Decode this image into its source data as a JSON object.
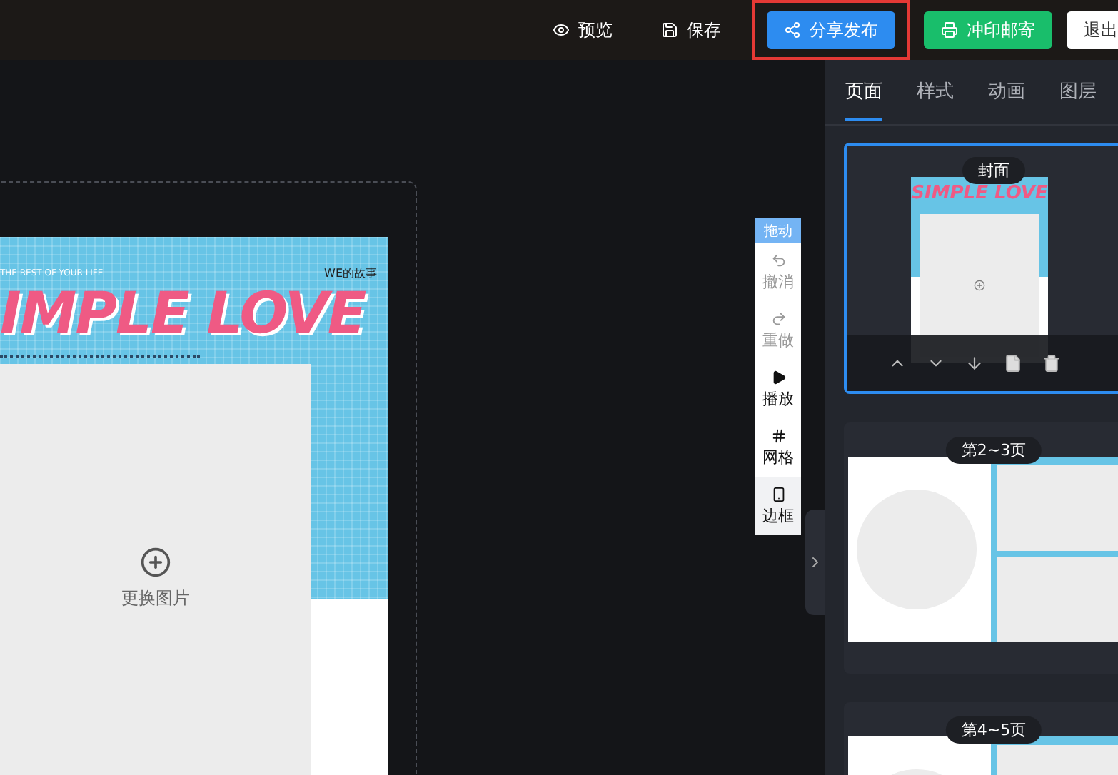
{
  "toolbar": {
    "actions": [
      {
        "kind": "preview",
        "label": "预览",
        "highlighted": false
      },
      {
        "kind": "save",
        "label": "保存",
        "highlighted": false
      },
      {
        "kind": "share",
        "label": "分享发布",
        "highlighted": true
      },
      {
        "kind": "print",
        "label": "冲印邮寄",
        "highlighted": false
      },
      {
        "kind": "exit",
        "label": "退出",
        "highlighted": false
      }
    ]
  },
  "canvas": {
    "poster": {
      "tagline": "THE REST OF YOUR LIFE",
      "badge": "WE的故事",
      "title": "IMPLE LOVE",
      "photo_label": "更换图片"
    }
  },
  "tool_strip": {
    "header": "拖动",
    "tools": [
      {
        "kind": "undo",
        "label": "撤消",
        "disabled": true,
        "selected": false
      },
      {
        "kind": "redo",
        "label": "重做",
        "disabled": true,
        "selected": false
      },
      {
        "kind": "play",
        "label": "播放",
        "disabled": false,
        "selected": false
      },
      {
        "kind": "grid",
        "label": "网格",
        "disabled": false,
        "selected": false
      },
      {
        "kind": "frame",
        "label": "边框",
        "disabled": false,
        "selected": true
      }
    ]
  },
  "panel": {
    "tabs": [
      {
        "label": "页面",
        "selected": true
      },
      {
        "label": "样式",
        "selected": false
      },
      {
        "label": "动画",
        "selected": false
      },
      {
        "label": "图层",
        "selected": false
      }
    ],
    "pages": [
      {
        "kind": "cover",
        "label": "封面",
        "thumb_title": "SIMPLE LOVE",
        "selected": true
      },
      {
        "kind": "spread",
        "label": "第2~3页",
        "selected": false
      },
      {
        "kind": "spread",
        "label": "第4~5页",
        "selected": false
      }
    ]
  }
}
